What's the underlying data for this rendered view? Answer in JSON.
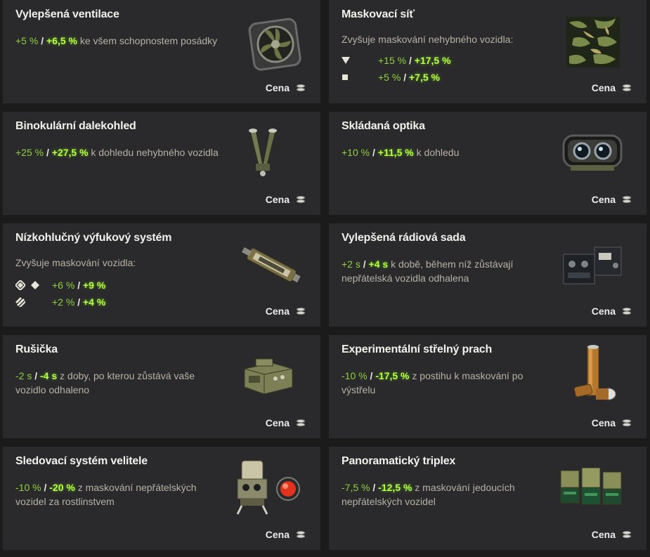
{
  "price_label": "Cena",
  "cards": [
    {
      "title": "Vylepšená ventilace",
      "v1": "+5 %",
      "v2": "+6,5 %",
      "text": "ke všem schopnostem posádky"
    },
    {
      "title": "Maskovací síť",
      "sub": "Zvyšuje maskování nehybného vozidla:",
      "rows": [
        {
          "v1": "+15 %",
          "v2": "+17,5 %"
        },
        {
          "v1": "+5 %",
          "v2": "+7,5 %"
        }
      ]
    },
    {
      "title": "Binokulární dalekohled",
      "v1": "+25 %",
      "v2": "+27,5 %",
      "text": "k dohledu nehybného vozidla"
    },
    {
      "title": "Skládaná optika",
      "v1": "+10 %",
      "v2": "+11,5 %",
      "text": "k dohledu"
    },
    {
      "title": "Nízkohlučný výfukový systém",
      "sub": "Zvyšuje maskování vozidla:",
      "rows": [
        {
          "v1": "+6 %",
          "v2": "+9 %"
        },
        {
          "v1": "+2 %",
          "v2": "+4 %"
        }
      ]
    },
    {
      "title": "Vylepšená rádiová sada",
      "v1": "+2 s",
      "v2": "+4 s",
      "text": "k době, během níž zůstávají nepřátelská vozidla odhalena"
    },
    {
      "title": "Rušička",
      "v1": "-2 s",
      "v2": "-4 s",
      "text": "z doby, po kterou zůstává vaše vozidlo odhaleno"
    },
    {
      "title": "Experimentální střelný prach",
      "v1": "-10 %",
      "v2": "-17,5 %",
      "text": "z postihu k maskování po výstřelu"
    },
    {
      "title": "Sledovací systém velitele",
      "v1": "-10 %",
      "v2": "-20 %",
      "text": "z maskování nepřátelských vozidel za rostlinstvem"
    },
    {
      "title": "Panoramatický triplex",
      "v1": "-7,5 %",
      "v2": "-12,5 %",
      "text": "z maskování jedoucích nepřátelských vozidel"
    }
  ]
}
